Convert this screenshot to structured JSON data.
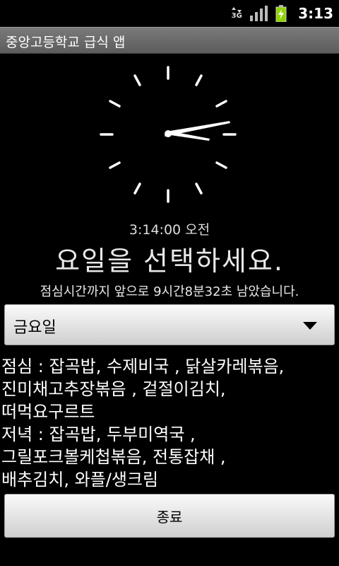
{
  "status_bar": {
    "network": "3G",
    "time": "3:13"
  },
  "app": {
    "title": "중앙고등학교 급식 앱"
  },
  "clock": {
    "digital_time": "3:14:00 오전"
  },
  "main": {
    "prompt": "요일을 선택하세요.",
    "countdown": "점심시간까지 앞으로 9시간8분32초 남았습니다."
  },
  "day_select": {
    "selected": "금요일"
  },
  "menu": {
    "lunch": "점심 : 잡곡밥, 수제비국 , 닭살카레볶음,\n진미채고추장볶음 , 겉절이김치,\n떠먹요구르트",
    "dinner": "저녁 : 잡곡밥, 두부미역국 ,\n그릴포크볼케첩볶음, 전통잡채 ,\n배추김치, 와플/생크림"
  },
  "buttons": {
    "exit_label": "종료"
  },
  "icons": {
    "network": "network-3g-icon",
    "signal": "signal-strength-icon",
    "battery": "battery-charging-icon"
  },
  "colors": {
    "background": "#000000",
    "title_bar": "#6b6b6b",
    "button_face": "#e6e6e6",
    "battery": "#8fd400"
  }
}
